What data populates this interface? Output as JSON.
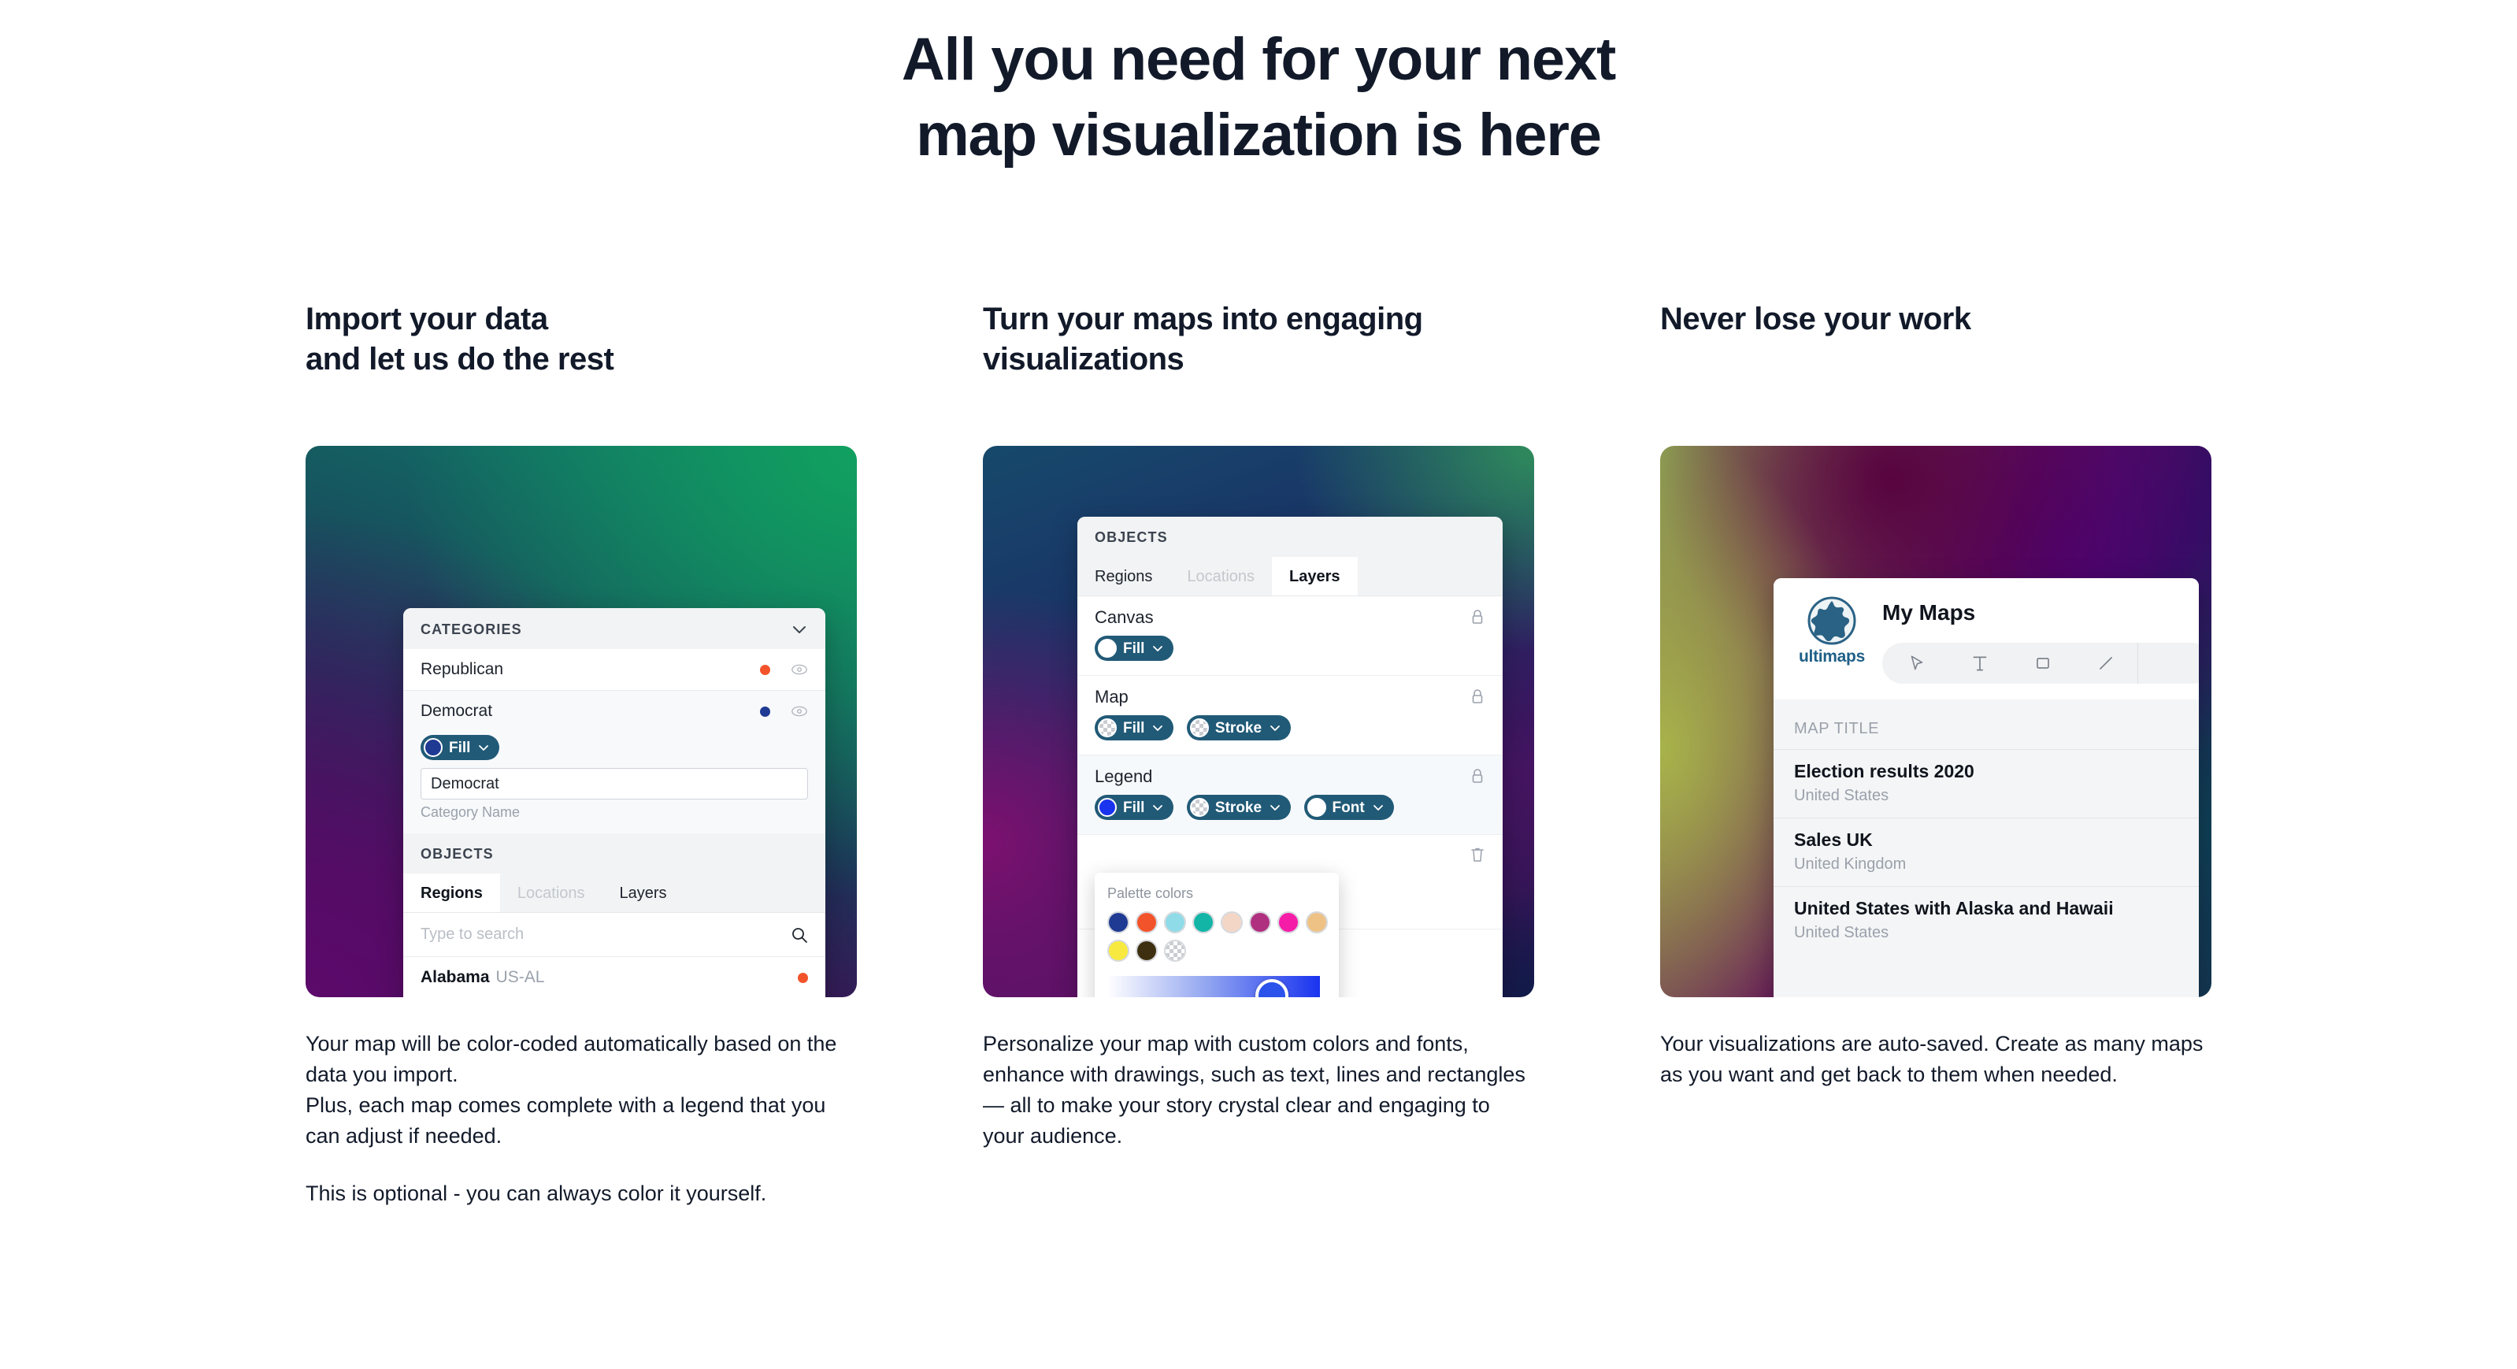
{
  "hero": {
    "line1": "All you need for your next",
    "line2": "map visualization is here",
    "color": "#121a2a"
  },
  "columns": [
    {
      "title_line1": "Import your data",
      "title_line2": "and let us do the rest",
      "body": [
        "Your map will be color-coded automatically based on the data you import.",
        "Plus, each map comes complete with a legend that you can adjust if needed.",
        "This is optional - you can always color it yourself."
      ],
      "card": {
        "gradient": "green-teal-purple",
        "panel": {
          "categories_header": "CATEGORIES",
          "rows": [
            {
              "label": "Republican",
              "dot_color": "#f2532a"
            },
            {
              "label": "Democrat",
              "dot_color": "#1f3a93"
            }
          ],
          "fill_pill": {
            "label": "Fill",
            "swatch_color": "#1f3a93"
          },
          "name_input_value": "Democrat",
          "name_input_caption": "Category Name",
          "objects_header": "OBJECTS",
          "tabs": [
            {
              "label": "Regions",
              "active": true
            },
            {
              "label": "Locations",
              "active": false
            },
            {
              "label": "Layers",
              "active": false
            }
          ],
          "search_placeholder": "Type to search",
          "region": {
            "name": "Alabama",
            "code": "US-AL",
            "dot_color": "#f2532a"
          }
        }
      }
    },
    {
      "title_line1": "Turn your maps into engaging",
      "title_line2": "visualizations",
      "body": [
        "Personalize your map with custom colors and fonts, enhance with drawings, such as text, lines and rectangles — all to make your story crystal clear and engaging to your audience."
      ],
      "card": {
        "gradient": "blue-purple-green",
        "panel": {
          "objects_header": "OBJECTS",
          "tabs": [
            {
              "label": "Regions",
              "active": false
            },
            {
              "label": "Locations",
              "active": false
            },
            {
              "label": "Layers",
              "active": true
            }
          ],
          "layers": [
            {
              "name": "Canvas",
              "locked": true,
              "pills": [
                {
                  "label": "Fill",
                  "swatch_color": "#ffffff"
                }
              ]
            },
            {
              "name": "Map",
              "locked": true,
              "pills": [
                {
                  "label": "Fill",
                  "swatch_color": "transparent"
                },
                {
                  "label": "Stroke",
                  "swatch_color": "transparent"
                }
              ]
            },
            {
              "name": "Legend",
              "locked": true,
              "highlighted": true,
              "pills": [
                {
                  "label": "Fill",
                  "swatch_color": "#1933ef"
                },
                {
                  "label": "Stroke",
                  "swatch_color": "transparent"
                },
                {
                  "label": "Font",
                  "swatch_color": "#ffffff"
                }
              ]
            }
          ],
          "popover": {
            "title": "Palette colors",
            "swatches": [
              "#1f3a93",
              "#f2532a",
              "#8fdbe8",
              "#12b5a6",
              "#f3d6c6",
              "#b03080",
              "#f51ca8",
              "#eec184",
              "#f7e93f",
              "#3d2f10",
              "transparent"
            ],
            "gradient_from": "#ffffff",
            "gradient_to": "#1933ef",
            "handle_color": "#2b52ea"
          }
        }
      }
    },
    {
      "title_line1": "Never lose your work",
      "title_line2": "",
      "body": [
        "Your visualizations are auto-saved. Create as many maps as you want and get back to them when needed."
      ],
      "card": {
        "gradient": "olive-magenta-navy",
        "panel": {
          "brand": "ultimaps",
          "title": "My Maps",
          "tools": [
            {
              "name": "cursor"
            },
            {
              "name": "text"
            },
            {
              "name": "rectangle"
            },
            {
              "name": "line"
            }
          ],
          "list_header": "MAP TITLE",
          "maps": [
            {
              "name": "Election results 2020",
              "region": "United States"
            },
            {
              "name": "Sales UK",
              "region": "United Kingdom"
            },
            {
              "name": "United States with Alaska and Hawaii",
              "region": "United States"
            }
          ]
        }
      }
    }
  ]
}
